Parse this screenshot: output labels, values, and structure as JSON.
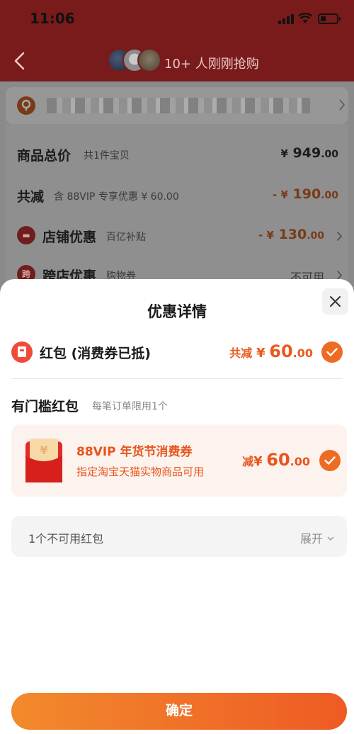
{
  "status_bar": {
    "time": "11:06"
  },
  "header": {
    "buyers_text": "10+ 人刚刚抢购"
  },
  "summary": {
    "rows": [
      {
        "label": "商品总价",
        "sub": "共1件宝贝",
        "yen": "¥",
        "value_main": "949",
        "value_dec": ".00"
      },
      {
        "label": "共减",
        "sub": "含 88VIP 专享优惠 ¥ 60.00",
        "yen": "- ¥",
        "value_main": "190",
        "value_dec": ".00"
      },
      {
        "label": "店铺优惠",
        "sub": "百亿补贴",
        "yen": "- ¥",
        "value_main": "130",
        "value_dec": ".00"
      },
      {
        "label": "跨店优惠",
        "sub": "购物券",
        "value_text": "不可用",
        "icon_text": "跨"
      }
    ]
  },
  "sheet": {
    "title": "优惠详情",
    "red_packet": {
      "label": "红包 (消费券已抵)",
      "prefix": "共减",
      "yen": "¥",
      "amount_main": "60",
      "amount_dec": ".00"
    },
    "section": {
      "title": "有门槛红包",
      "subtitle": "每笔订单限用1个"
    },
    "coupon": {
      "name": "88VIP 年货节消费券",
      "desc": "指定淘宝天猫实物商品可用",
      "prefix": "减",
      "yen": "¥",
      "amount_main": "60",
      "amount_dec": ".00"
    },
    "unavailable": {
      "label": "1个不可用红包",
      "expand": "展开"
    },
    "confirm": "确定"
  },
  "colors": {
    "accent": "#ee6b22",
    "coupon_bg": "#fdf3ee",
    "header_red": "#7a1b1b"
  }
}
